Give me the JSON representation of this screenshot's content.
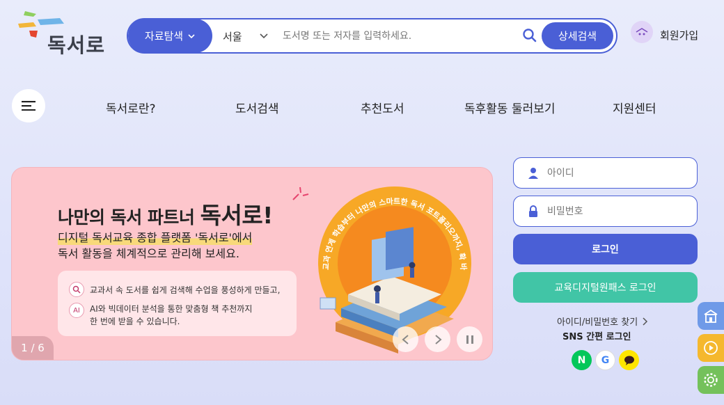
{
  "header": {
    "logo_text": "독서로",
    "search": {
      "category_label": "자료탐색",
      "region_label": "서울",
      "placeholder": "도서명 또는 저자를 입력하세요.",
      "advanced_label": "상세검색"
    },
    "signup_label": "회원가입"
  },
  "nav": {
    "items": [
      {
        "label": "독서로란?"
      },
      {
        "label": "도서검색"
      },
      {
        "label": "추천도서"
      },
      {
        "label": "독후활동 둘러보기"
      },
      {
        "label": "지원센터"
      }
    ]
  },
  "banner": {
    "title_prefix": "나만의 독서 파트너 ",
    "title_brand": "독서로!",
    "subtitle_line1": "디지털 독서교육 종합 플랫폼 '독서로'에서",
    "subtitle_line2": "독서 활동을 체계적으로 관리해 보세요.",
    "feature1": "교과서 속 도서를 쉽게 검색해 수업을 풍성하게 만들고,",
    "feature2_line1": "AI와 빅데이터 분석을 통한 맞춤형 책 추천까지",
    "feature2_line2": "한 번에 받을 수 있습니다.",
    "ai_badge": "AI",
    "circle_text": "교과 연계 학습부터 나만의 스마트한 독서 포트폴리오까지, 확 바뀐 '독서로'가 든든하게 지원합니다.",
    "pager": "1 / 6"
  },
  "login": {
    "id_placeholder": "아이디",
    "pw_placeholder": "비밀번호",
    "login_label": "로그인",
    "edu_login_label": "교육디지털원패스 로그인",
    "find_label": "아이디/비밀번호 찾기",
    "sns_label": "SNS 간편 로그인",
    "naver_glyph": "N",
    "google_glyph": "G"
  },
  "colors": {
    "primary": "#4a5fd6",
    "teal": "#41c5a6",
    "banner_bg": "#fdc6cc",
    "naver": "#03c75a",
    "kakao": "#fee500",
    "side_blue": "#6f9ae8",
    "side_yellow": "#f5b82e",
    "side_green": "#74c15b"
  }
}
